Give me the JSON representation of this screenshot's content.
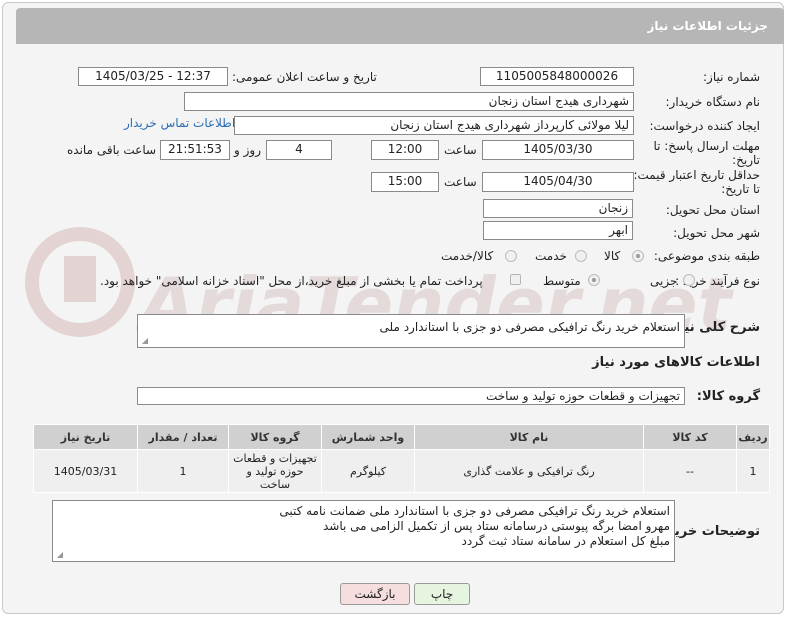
{
  "header": {
    "title": "جزئیات اطلاعات نیاز"
  },
  "fields": {
    "need_number_label": "شماره نیاز:",
    "need_number": "1105005848000026",
    "announce_label": "تاریخ و ساعت اعلان عمومی:",
    "announce_value": "1405/03/25 - 12:37",
    "buyer_label": "نام دستگاه خریدار:",
    "buyer_value": "شهرداری هیدج استان زنجان",
    "creator_label": "ایجاد کننده درخواست:",
    "creator_value": "لیلا مولائی کارپرداز شهرداری هیدج استان زنجان",
    "contact_link": "اطلاعات تماس خریدار",
    "deadline_label_1": "مهلت ارسال پاسخ: تا",
    "deadline_label_2": "تاریخ:",
    "deadline_date": "1405/03/30",
    "time_label": "ساعت",
    "deadline_time": "12:00",
    "days_value": "4",
    "days_label": "روز و",
    "remaining_value": "21:51:53",
    "remaining_label": "ساعت باقی مانده",
    "price_label_1": "حداقل تاریخ اعتبار قیمت:",
    "price_label_2": "تا تاریخ:",
    "price_date": "1405/04/30",
    "price_time": "15:00",
    "province_label": "استان محل تحویل:",
    "province_value": "زنجان",
    "city_label": "شهر محل تحویل:",
    "city_value": "ابهر",
    "category_label": "طبقه بندی موضوعی:",
    "category_options": [
      "کالا",
      "خدمت",
      "کالا/خدمت"
    ],
    "category_selected": "کالا",
    "process_label": "نوع فرآیند خرید :",
    "process_options": [
      "جزیی",
      "متوسط"
    ],
    "process_selected": "متوسط",
    "payment_note": "پرداخت تمام یا بخشی از مبلغ خرید،از محل \"اسناد خزانه اسلامی\" خواهد بود.",
    "general_desc_label": "شرح کلی نیاز:",
    "general_desc": "استعلام خرید رنگ ترافیکی مصرفی دو جزی با استاندارد ملی",
    "goods_info_title": "اطلاعات کالاهای مورد نیاز",
    "goods_group_label": "گروه کالا:",
    "goods_group_value": "تجهیزات و قطعات حوزه تولید و ساخت",
    "buyer_notes_label": "توضیحات خریدار:",
    "buyer_notes": [
      "استعلام خرید رنگ ترافیکی مصرفی دو جزی با استاندارد ملی ضمانت نامه کتبی",
      "مهرو امضا برگه پیوستی درسامانه ستاد پس از تکمیل الزامی می باشد",
      "مبلغ کل استعلام در سامانه ستاد ثبت گردد"
    ]
  },
  "table": {
    "headers": [
      "ردیف",
      "کد کالا",
      "نام کالا",
      "واحد شمارش",
      "گروه کالا",
      "تعداد / مقدار",
      "تاریخ نیاز"
    ],
    "rows": [
      [
        "1",
        "--",
        "رنگ ترافیکی و علامت گذاری",
        "کیلوگرم",
        "تجهیزات و قطعات حوزه تولید و ساخت",
        "1",
        "1405/03/31"
      ]
    ]
  },
  "buttons": {
    "print": "چاپ",
    "back": "بازگشت"
  },
  "watermark": "AriaTender.net",
  "colors": {
    "header_bg": "#b6b6b6",
    "link": "#2a6db5",
    "back_button_bg": "#f6dede",
    "print_button_bg": "#e6f5e0"
  }
}
